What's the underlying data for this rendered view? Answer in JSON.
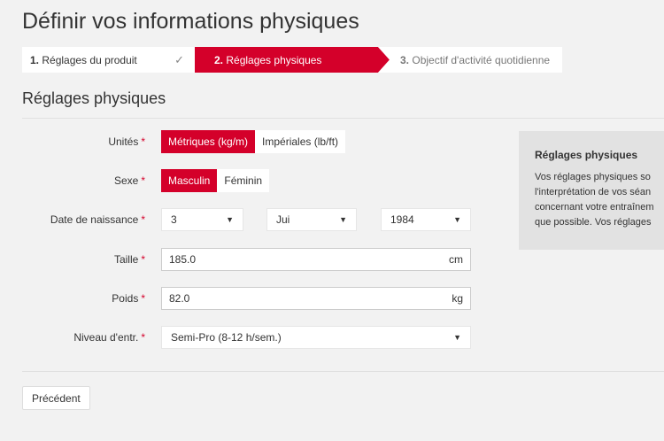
{
  "page": {
    "title": "Définir vos informations physiques"
  },
  "stepper": {
    "steps": [
      {
        "num": "1.",
        "label": "Réglages du produit",
        "status": "done"
      },
      {
        "num": "2.",
        "label": "Réglages physiques",
        "status": "active"
      },
      {
        "num": "3.",
        "label": "Objectif d'activité quotidienne",
        "status": "pending"
      }
    ]
  },
  "section": {
    "title": "Réglages physiques"
  },
  "form": {
    "units": {
      "label": "Unités",
      "options": [
        "Métriques (kg/m)",
        "Impériales (lb/ft)"
      ],
      "selected": "Métriques (kg/m)"
    },
    "sex": {
      "label": "Sexe",
      "options": [
        "Masculin",
        "Féminin"
      ],
      "selected": "Masculin"
    },
    "birthdate": {
      "label": "Date de naissance",
      "day": "3",
      "month": "Jui",
      "year": "1984"
    },
    "height": {
      "label": "Taille",
      "value": "185.0",
      "unit": "cm"
    },
    "weight": {
      "label": "Poids",
      "value": "82.0",
      "unit": "kg"
    },
    "level": {
      "label": "Niveau d'entr.",
      "value": "Semi-Pro (8-12 h/sem.)"
    },
    "required_mark": "*"
  },
  "info": {
    "title": "Réglages physiques",
    "lines": [
      "Vos réglages physiques so",
      "l'interprétation de vos séan",
      "concernant votre entraînem",
      "que possible. Vos réglages"
    ]
  },
  "footer": {
    "back_label": "Précédent"
  },
  "colors": {
    "accent": "#d4002a",
    "background": "#f2f2f2",
    "panel": "#e2e2e2"
  }
}
